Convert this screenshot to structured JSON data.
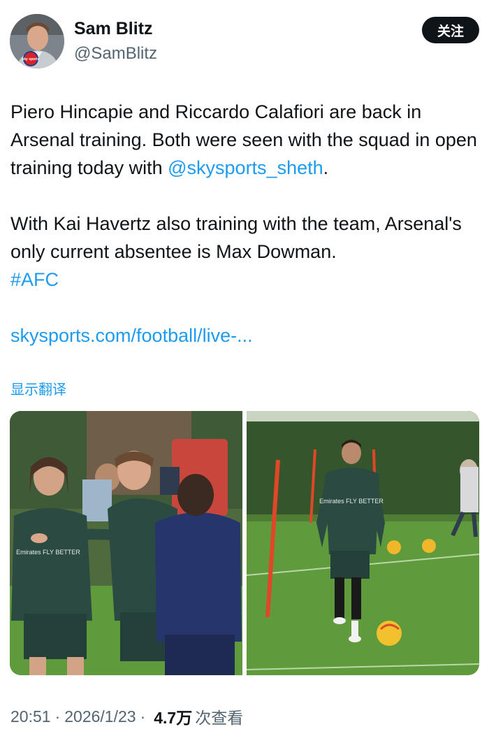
{
  "header": {
    "display_name": "Sam Blitz",
    "handle": "@SamBlitz",
    "follow_label": "关注",
    "avatar_badge_text": "sky sports"
  },
  "tweet": {
    "paragraph1_part1": "Piero Hincapie and Riccardo Calafiori are back in Arsenal training. Both were seen with the squad in open training today with ",
    "mention": "@skysports_sheth",
    "paragraph1_end": ".",
    "paragraph2": "With Kai Havertz also training with the team, Arsenal's only current absentee is Max Dowman.",
    "hashtag": "#AFC",
    "link": "skysports.com/football/live-..."
  },
  "translate_label": "显示翻译",
  "media": {
    "left_photo_alt": "Arsenal players laughing during training",
    "right_photo_alt": "Arsenal player walking toward a ball on training pitch",
    "shirt_text": "Emirates FLY BETTER"
  },
  "meta": {
    "time": "20:51",
    "date": "2026/1/23",
    "views_count": "4.7万",
    "views_label": "次查看"
  },
  "colors": {
    "link": "#1d9bf0",
    "text": "#0f1419",
    "secondary": "#536471",
    "follow_button": "#0f1419",
    "pitch_green": "#5f9a3c",
    "kit_dark_green": "#2b4a42"
  }
}
